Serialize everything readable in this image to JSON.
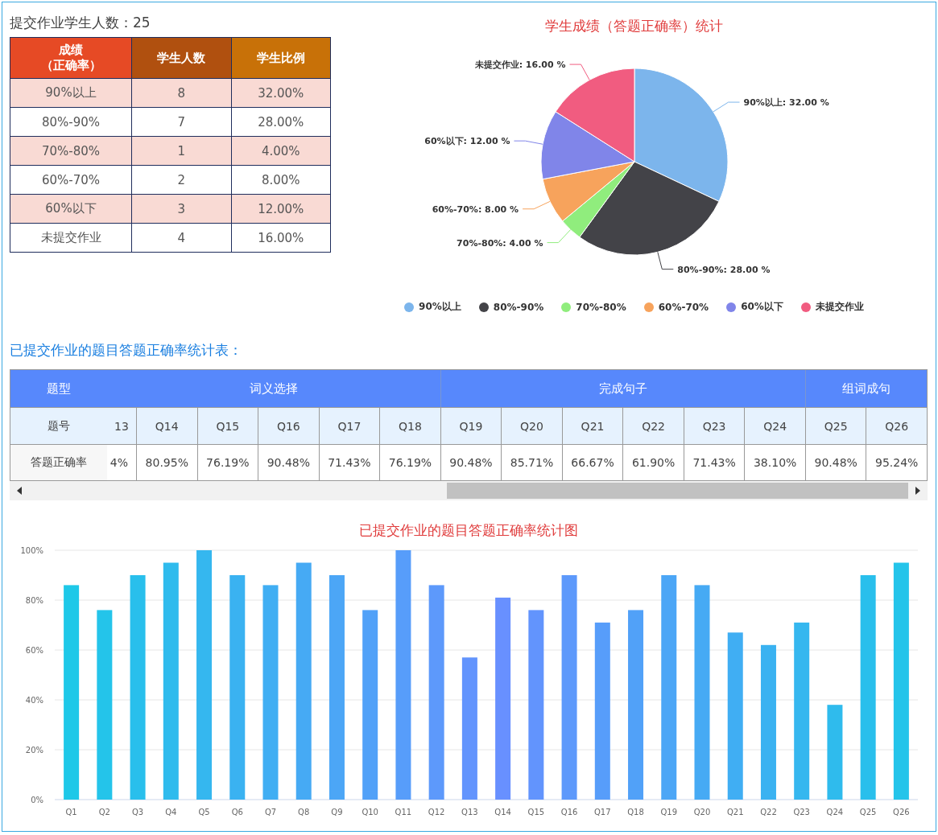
{
  "summary": "提交作业学生人数：25",
  "score_table": {
    "columns": [
      {
        "title": "成绩",
        "subtitle": "（正确率）"
      },
      {
        "title": "学生人数"
      },
      {
        "title": "学生比例"
      }
    ],
    "rows": [
      [
        "90%以上",
        "8",
        "32.00%"
      ],
      [
        "80%-90%",
        "7",
        "28.00%"
      ],
      [
        "70%-80%",
        "1",
        "4.00%"
      ],
      [
        "60%-70%",
        "2",
        "8.00%"
      ],
      [
        "60%以下",
        "3",
        "12.00%"
      ],
      [
        "未提交作业",
        "4",
        "16.00%"
      ]
    ]
  },
  "pie": {
    "chart_data": {
      "type": "pie",
      "title": "学生成绩（答题正确率）统计",
      "values": [
        32,
        28,
        4,
        8,
        12,
        16
      ],
      "value_labels": [
        "90%以上: 32.00 %",
        "80%-90%: 28.00 %",
        "70%-80%: 4.00 %",
        "60%-70%: 8.00 %",
        "60%以下: 12.00 %",
        "未提交作业: 16.00 %"
      ]
    },
    "legend": [
      {
        "label": "90%以上",
        "color": "#7cb5ec"
      },
      {
        "label": "80%-90%",
        "color": "#434348"
      },
      {
        "label": "70%-80%",
        "color": "#90ed7d"
      },
      {
        "label": "60%-70%",
        "color": "#f7a35c"
      },
      {
        "label": "60%以下",
        "color": "#8085e9"
      },
      {
        "label": "未提交作业",
        "color": "#f15c80"
      }
    ]
  },
  "accuracy_heading": "已提交作业的题目答题正确率统计表：",
  "accuracy_table": {
    "row_labels": [
      "题型",
      "题号",
      "答题正确率"
    ],
    "groups": [
      {
        "label": "词义选择",
        "questions": [
          {
            "number": "13",
            "accuracy": "4%"
          },
          {
            "number": "Q14",
            "accuracy": "80.95%"
          },
          {
            "number": "Q15",
            "accuracy": "76.19%"
          },
          {
            "number": "Q16",
            "accuracy": "90.48%"
          },
          {
            "number": "Q17",
            "accuracy": "71.43%"
          },
          {
            "number": "Q18",
            "accuracy": "76.19%"
          }
        ]
      },
      {
        "label": "完成句子",
        "questions": [
          {
            "number": "Q19",
            "accuracy": "90.48%"
          },
          {
            "number": "Q20",
            "accuracy": "85.71%"
          },
          {
            "number": "Q21",
            "accuracy": "66.67%"
          },
          {
            "number": "Q22",
            "accuracy": "61.90%"
          },
          {
            "number": "Q23",
            "accuracy": "71.43%"
          },
          {
            "number": "Q24",
            "accuracy": "38.10%"
          }
        ]
      },
      {
        "label": "组词成句",
        "questions": [
          {
            "number": "Q25",
            "accuracy": "90.48%"
          },
          {
            "number": "Q26",
            "accuracy": "95.24%"
          }
        ]
      }
    ]
  },
  "bar_chart": {
    "chart_data": {
      "type": "bar",
      "title": "已提交作业的题目答题正确率统计图",
      "categories": [
        "Q1",
        "Q2",
        "Q3",
        "Q4",
        "Q5",
        "Q6",
        "Q7",
        "Q8",
        "Q9",
        "Q10",
        "Q11",
        "Q12",
        "Q13",
        "Q14",
        "Q15",
        "Q16",
        "Q17",
        "Q18",
        "Q19",
        "Q20",
        "Q21",
        "Q22",
        "Q23",
        "Q24",
        "Q25",
        "Q26"
      ],
      "values": [
        86,
        76,
        90,
        95,
        100,
        90,
        86,
        95,
        90,
        76,
        100,
        86,
        57,
        81,
        76,
        90,
        71,
        76,
        90,
        86,
        67,
        62,
        71,
        38,
        90,
        95
      ],
      "ylim": [
        0,
        100
      ],
      "grid": true,
      "yticks": [
        {
          "value": 0,
          "label": "0%"
        },
        {
          "value": 20,
          "label": "20%"
        },
        {
          "value": 40,
          "label": "40%"
        },
        {
          "value": 60,
          "label": "60%"
        },
        {
          "value": 80,
          "label": "80%"
        },
        {
          "value": 100,
          "label": "100%"
        }
      ]
    }
  }
}
